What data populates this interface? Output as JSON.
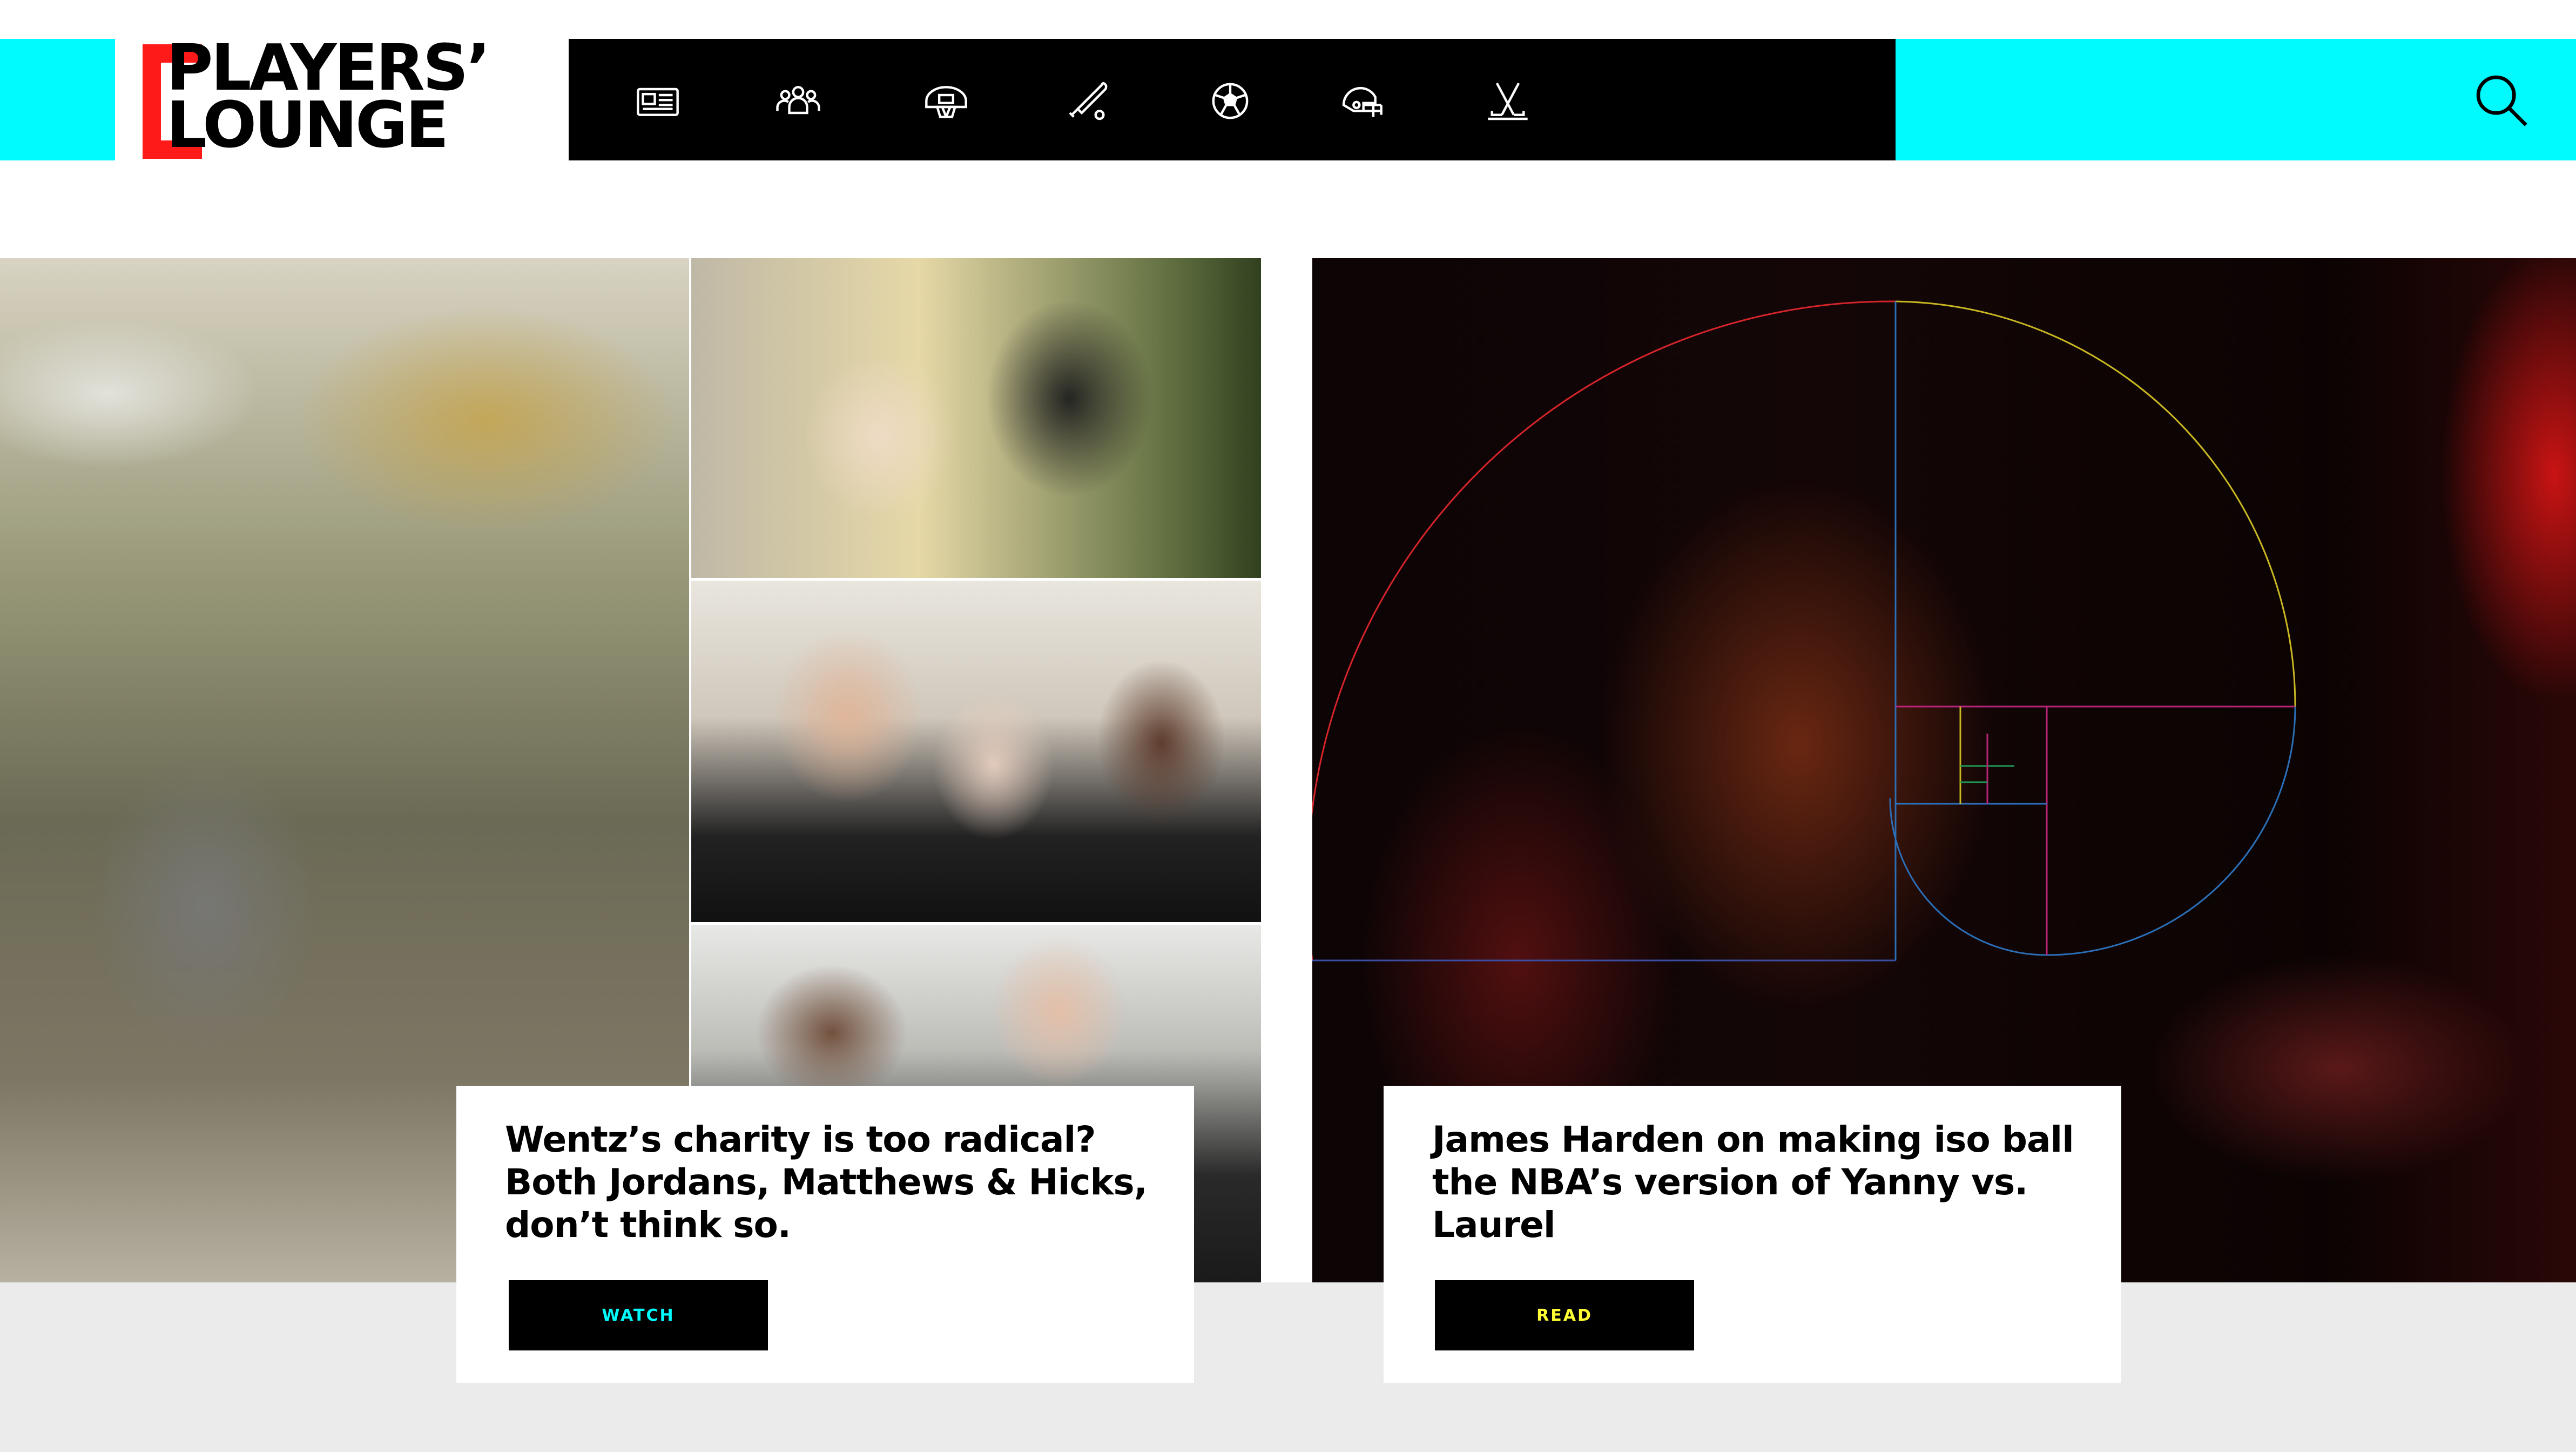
{
  "brand": {
    "logo_line1": "PLAYERS’",
    "logo_line2": "LOUNGE",
    "accent_cyan": "#00FBFF",
    "accent_red": "#FF1A1A",
    "accent_yellow": "#FFFF33"
  },
  "nav": {
    "items": [
      {
        "icon": "newspaper-icon"
      },
      {
        "icon": "people-icon"
      },
      {
        "icon": "basketball-hoop-icon"
      },
      {
        "icon": "baseball-bat-icon"
      },
      {
        "icon": "soccer-ball-icon"
      },
      {
        "icon": "football-helmet-icon"
      },
      {
        "icon": "hockey-sticks-icon"
      }
    ],
    "search_icon": "search-icon"
  },
  "stories": [
    {
      "headline": "Wentz’s charity is too radical? Both Jordans, Matthews & Hicks, don’t think so.",
      "cta": "WATCH"
    },
    {
      "headline": "James Harden on making iso ball the NBA’s version of Yanny vs. Laurel",
      "cta": "READ"
    }
  ]
}
